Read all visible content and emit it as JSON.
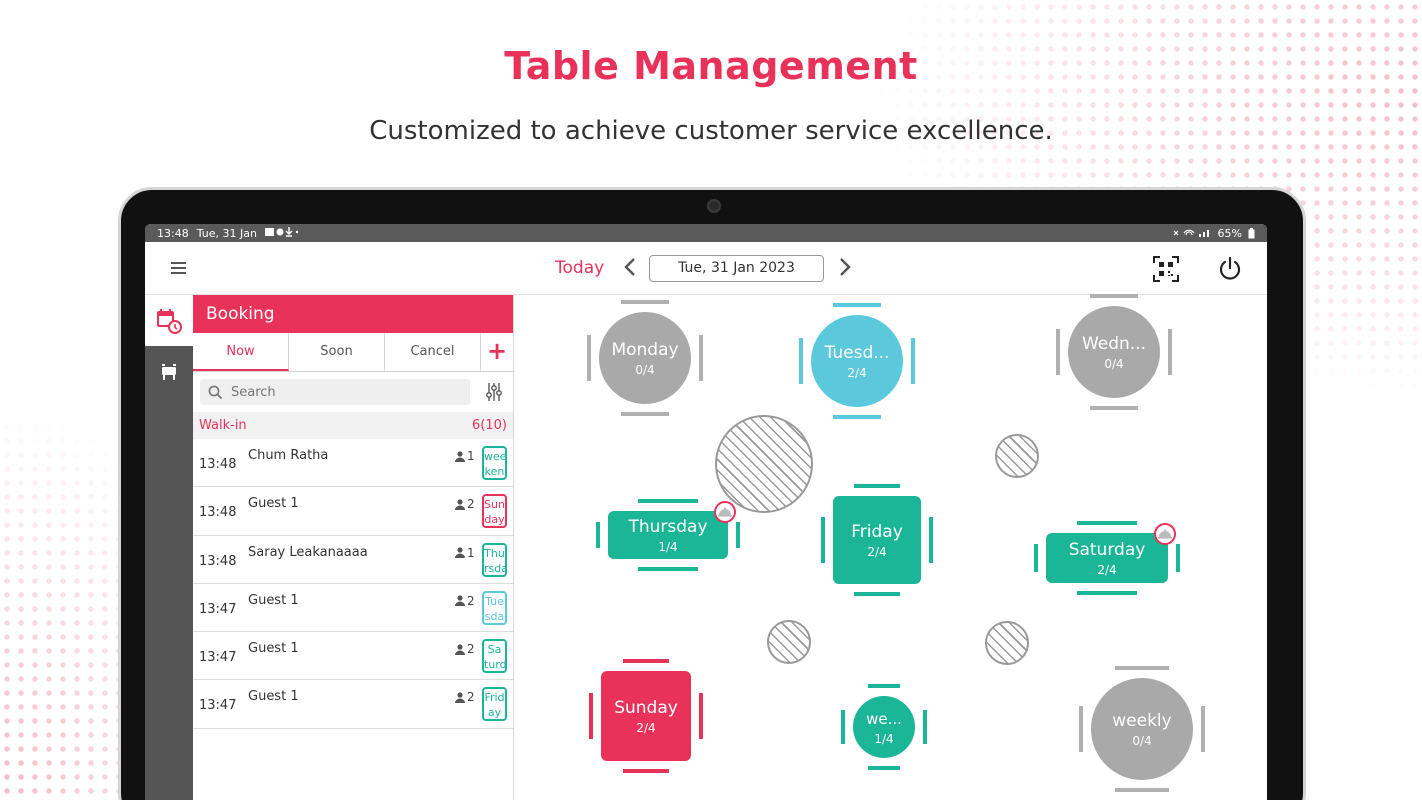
{
  "promo": {
    "title": "Table Management",
    "subtitle": "Customized to achieve customer service excellence."
  },
  "statusbar": {
    "time": "13:48",
    "date": "Tue, 31 Jan",
    "battery": "65%"
  },
  "topbar": {
    "today_label": "Today",
    "date_value": "Tue, 31 Jan 2023"
  },
  "booking": {
    "title": "Booking",
    "tabs": [
      "Now",
      "Soon",
      "Cancel"
    ],
    "add_label": "+",
    "search_placeholder": "Search",
    "section_label": "Walk-in",
    "section_count": "6(10)",
    "rows": [
      {
        "time": "13:48",
        "name": "Chum Ratha",
        "guests": "1",
        "tag": "wee ken",
        "tag_color": "#1bb598"
      },
      {
        "time": "13:48",
        "name": "Guest 1",
        "guests": "2",
        "tag": "Sun day",
        "tag_color": "#e8325a"
      },
      {
        "time": "13:48",
        "name": "Saray Leakanaaaa",
        "guests": "1",
        "tag": "Thu rsda",
        "tag_color": "#1bb598"
      },
      {
        "time": "13:47",
        "name": "Guest 1",
        "guests": "2",
        "tag": "Tue sda",
        "tag_color": "#5bc8dc"
      },
      {
        "time": "13:47",
        "name": "Guest 1",
        "guests": "2",
        "tag": "Sa turd",
        "tag_color": "#1bb598"
      },
      {
        "time": "13:47",
        "name": "Guest 1",
        "guests": "2",
        "tag": "Frid ay",
        "tag_color": "#1bb598"
      }
    ]
  },
  "tables": [
    {
      "name": "Monday",
      "count": "0/4",
      "color": "#a9a9a9"
    },
    {
      "name": "Tuesd...",
      "count": "2/4",
      "color": "#5bc8dc"
    },
    {
      "name": "Wedn...",
      "count": "0/4",
      "color": "#a9a9a9"
    },
    {
      "name": "Thursday",
      "count": "1/4",
      "color": "#1bb598"
    },
    {
      "name": "Friday",
      "count": "2/4",
      "color": "#1bb598"
    },
    {
      "name": "Saturday",
      "count": "2/4",
      "color": "#1bb598"
    },
    {
      "name": "Sunday",
      "count": "2/4",
      "color": "#e8325a"
    },
    {
      "name": "we...",
      "count": "1/4",
      "color": "#1bb598"
    },
    {
      "name": "weekly",
      "count": "0/4",
      "color": "#a9a9a9"
    }
  ],
  "colors": {
    "accent": "#e8325a",
    "occupied": "#1bb598",
    "reserved": "#5bc8dc",
    "empty": "#a9a9a9"
  },
  "icons": {
    "menu": "hamburger-icon",
    "prev": "chevron-left-icon",
    "next": "chevron-right-icon",
    "qr": "qr-scan-icon",
    "power": "power-icon",
    "booking": "calendar-clock-icon",
    "floor": "tables-icon",
    "search": "search-icon",
    "filter": "filter-sliders-icon",
    "guest": "person-icon",
    "service": "cloche-icon"
  }
}
